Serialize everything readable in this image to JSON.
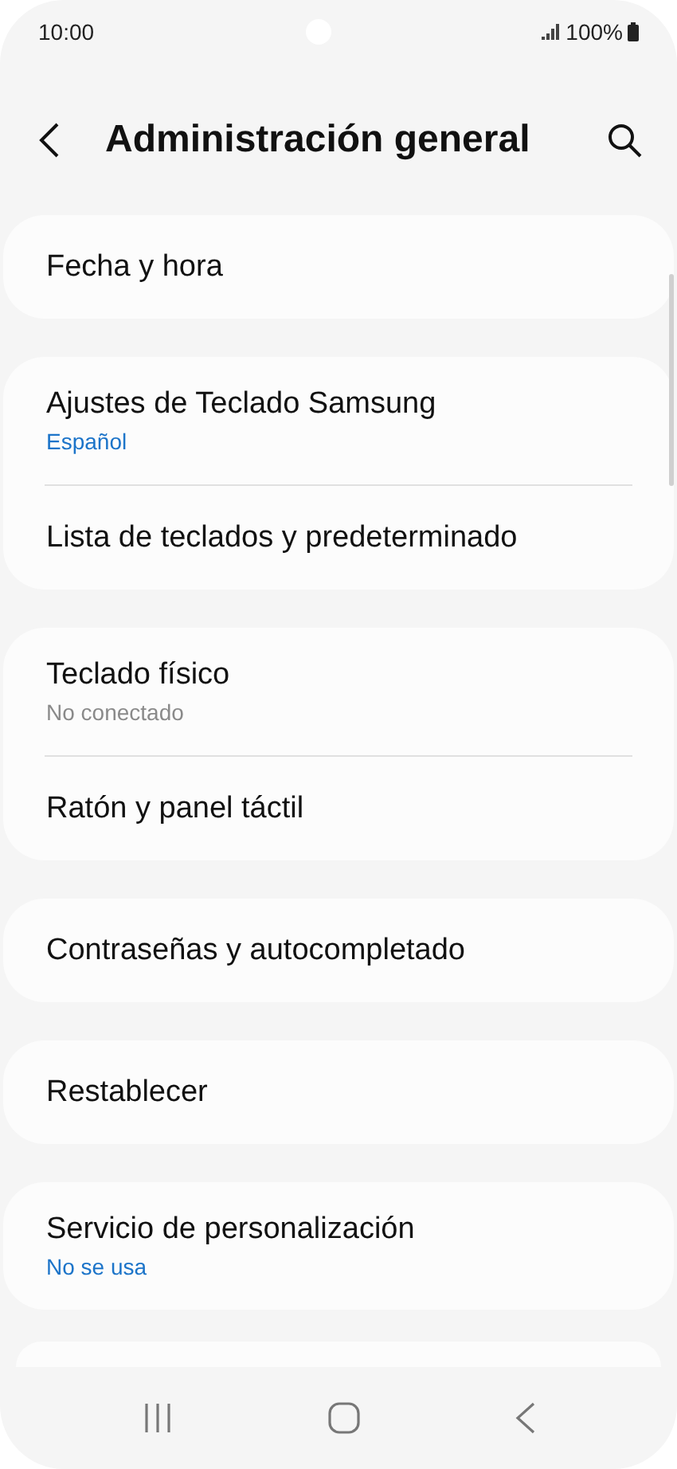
{
  "status_bar": {
    "time": "10:00",
    "battery": "100%"
  },
  "header": {
    "title": "Administración general"
  },
  "groups": [
    {
      "items": [
        {
          "title": "Fecha y hora"
        }
      ]
    },
    {
      "items": [
        {
          "title": "Ajustes de Teclado Samsung",
          "subtitle": "Español",
          "kind": "accent"
        },
        {
          "title": "Lista de teclados y predeterminado"
        }
      ]
    },
    {
      "items": [
        {
          "title": "Teclado físico",
          "subtitle": "No conectado",
          "kind": "muted"
        },
        {
          "title": "Ratón y panel táctil"
        }
      ]
    },
    {
      "items": [
        {
          "title": "Contraseñas y autocompletado"
        }
      ]
    },
    {
      "items": [
        {
          "title": "Restablecer"
        }
      ]
    },
    {
      "items": [
        {
          "title": "Servicio de personalización",
          "subtitle": "No se usa",
          "kind": "accent"
        }
      ]
    }
  ]
}
